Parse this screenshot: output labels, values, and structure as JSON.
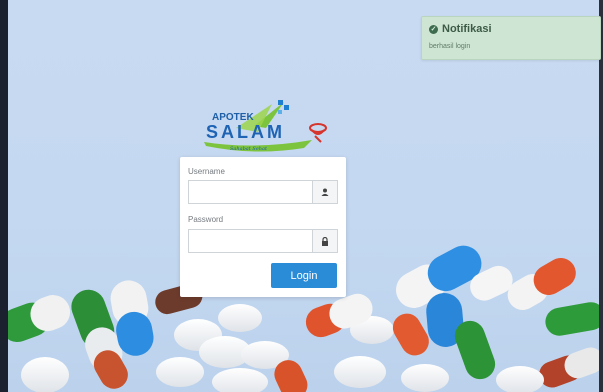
{
  "notification": {
    "title": "Notifikasi",
    "message": "berhasil login",
    "icon": "check-circle-icon",
    "color": "#cfe5d4"
  },
  "logo": {
    "line1": "APOTEK",
    "line2": "SALAM",
    "tagline": "Sahabat Sehat"
  },
  "form": {
    "username_label": "Username",
    "username_value": "",
    "username_icon": "user-icon",
    "password_label": "Password",
    "password_value": "",
    "password_icon": "lock-icon",
    "login_label": "Login",
    "accent": "#2a8bd6"
  }
}
